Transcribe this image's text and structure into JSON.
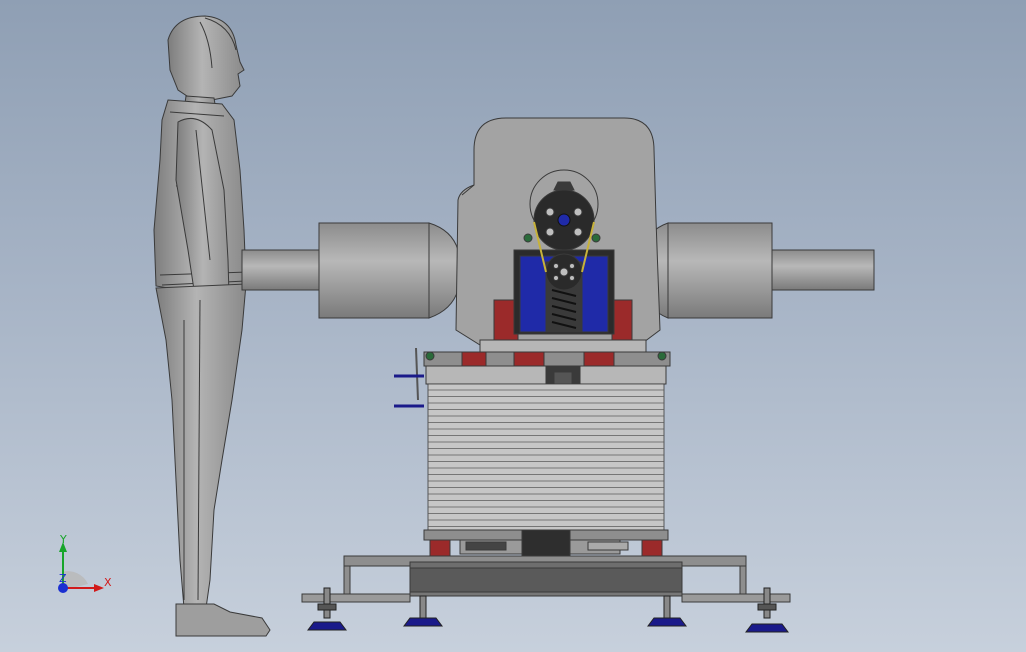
{
  "viewport": {
    "background_top": "#8f9fb4",
    "background_bottom": "#c7d0dc"
  },
  "model": {
    "human_figure": "human-reference-figure",
    "machine": "rotating-arm-test-machine",
    "colors": {
      "metal_light": "#b9b9b9",
      "metal_mid": "#9a9a9a",
      "metal_dark": "#555555",
      "motor_blue": "#1f2aa8",
      "accent_red": "#9b2a2a",
      "foot_blue": "#1a1a8a",
      "bolt_green": "#2a6a3a"
    }
  },
  "triad": {
    "x_label": "X",
    "y_label": "Y",
    "z_label": "Z",
    "x_color": "#d11a1a",
    "y_color": "#17a52a",
    "z_color": "#1a2fd1"
  }
}
